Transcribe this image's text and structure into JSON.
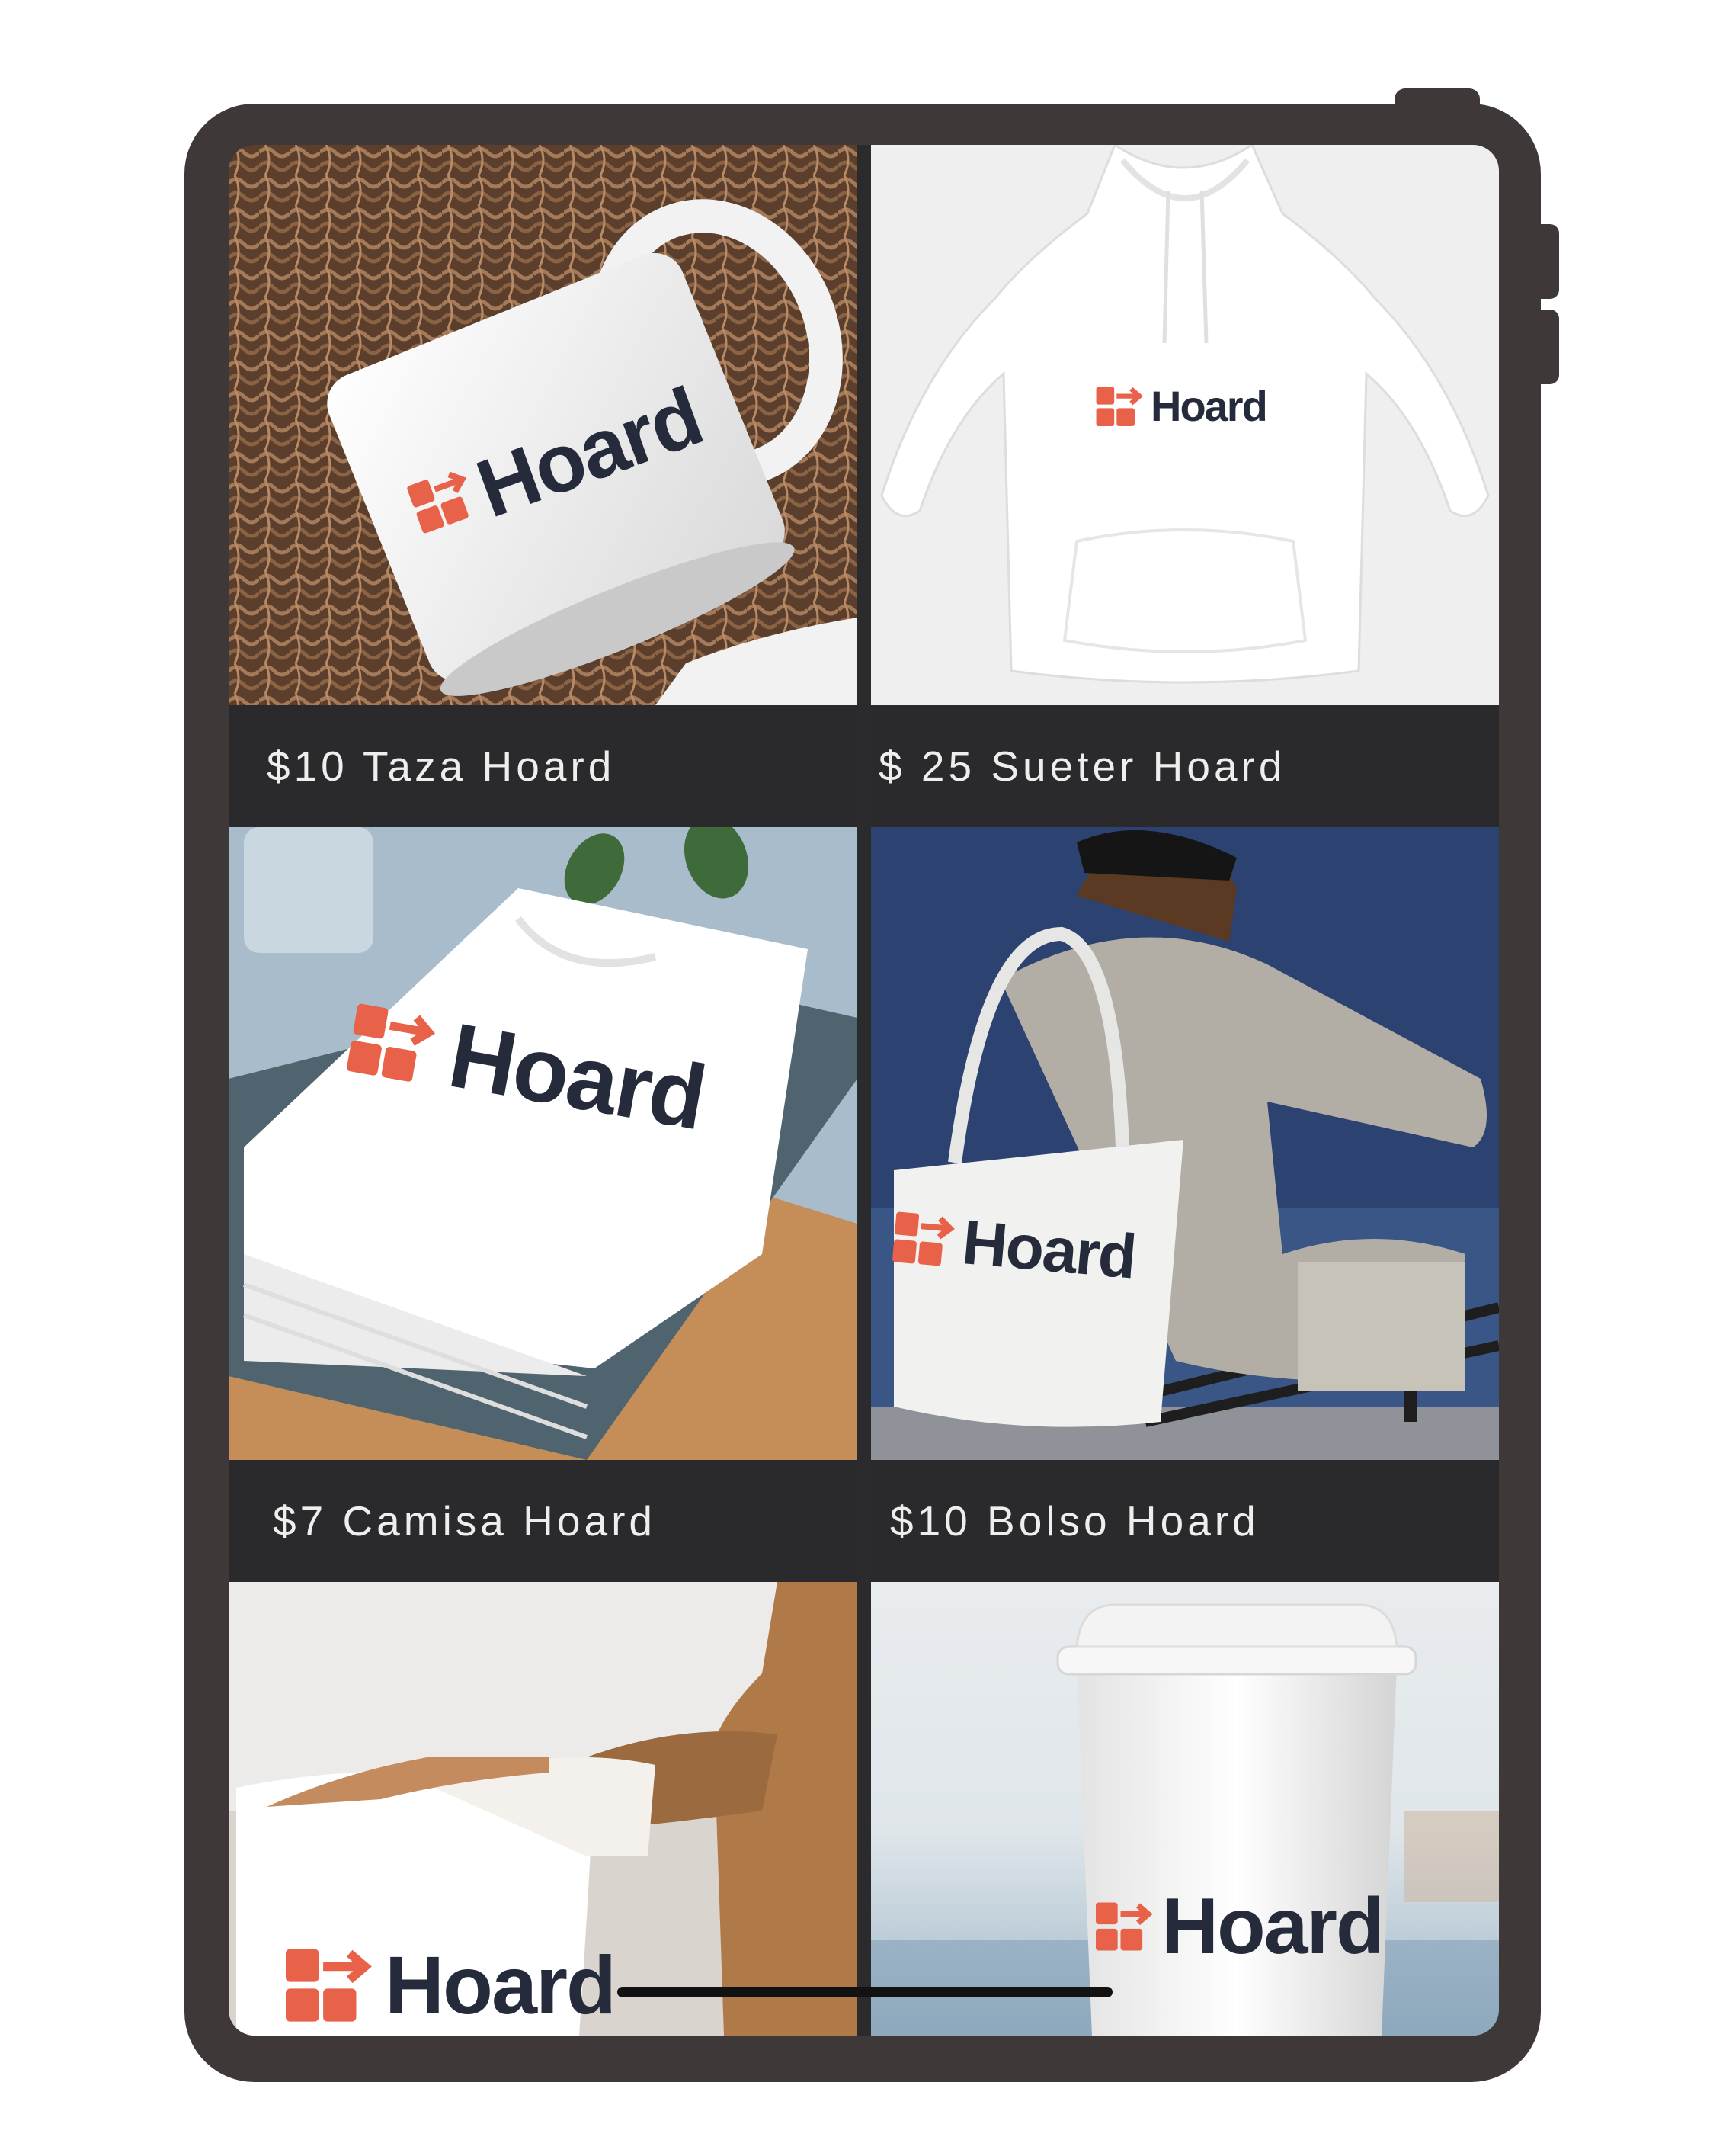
{
  "brand": {
    "logo_text": "Hoard",
    "logo_color": "#262b3c",
    "mark_color": "#e8624a"
  },
  "products": [
    {
      "caption": "$10 Taza Hoard",
      "item": "mug"
    },
    {
      "caption": "$ 25 Sueter Hoard",
      "item": "hoodie"
    },
    {
      "caption": "$7 Camisa Hoard",
      "item": "t-shirt"
    },
    {
      "caption": "$10 Bolso Hoard",
      "item": "tote-bag"
    },
    {
      "caption": "",
      "item": "pillow"
    },
    {
      "caption": "",
      "item": "coffee-cup"
    }
  ]
}
